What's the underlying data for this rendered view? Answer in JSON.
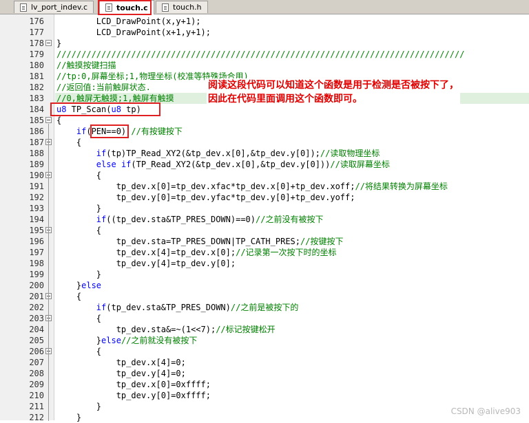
{
  "tabs": [
    {
      "label": "lv_port_indev.c"
    },
    {
      "label": "touch.c"
    },
    {
      "label": "touch.h"
    }
  ],
  "annotation": {
    "line1": "阅读这段代码可以知道这个函数是用于检测是否被按下了，",
    "line2": "因此在代码里面调用这个函数即可。"
  },
  "watermark": "CSDN @alive903",
  "lines": [
    {
      "n": "176",
      "t": "        LCD_DrawPoint(x,y+1);"
    },
    {
      "n": "177",
      "t": "        LCD_DrawPoint(x+1,y+1);"
    },
    {
      "n": "178",
      "t": "}"
    },
    {
      "n": "179",
      "t": "//////////////////////////////////////////////////////////////////////////////////"
    },
    {
      "n": "180",
      "t": "//触摸按键扫描"
    },
    {
      "n": "181",
      "t": "//tp:0,屏幕坐标;1,物理坐标(校准等特殊场合用)"
    },
    {
      "n": "182",
      "t": "//返回值:当前触屏状态."
    },
    {
      "n": "183",
      "t": "//0,触屏无触摸;1,触屏有触摸"
    },
    {
      "n": "184",
      "t": "u8 TP_Scan(u8 tp)"
    },
    {
      "n": "185",
      "t": "{"
    },
    {
      "n": "186",
      "t": "    if(PEN==0) //有按键按下"
    },
    {
      "n": "187",
      "t": "    {"
    },
    {
      "n": "188",
      "t": "        if(tp)TP_Read_XY2(&tp_dev.x[0],&tp_dev.y[0]);//读取物理坐标"
    },
    {
      "n": "189",
      "t": "        else if(TP_Read_XY2(&tp_dev.x[0],&tp_dev.y[0]))//读取屏幕坐标"
    },
    {
      "n": "190",
      "t": "        {"
    },
    {
      "n": "191",
      "t": "            tp_dev.x[0]=tp_dev.xfac*tp_dev.x[0]+tp_dev.xoff;//将结果转换为屏幕坐标"
    },
    {
      "n": "192",
      "t": "            tp_dev.y[0]=tp_dev.yfac*tp_dev.y[0]+tp_dev.yoff;"
    },
    {
      "n": "193",
      "t": "        }"
    },
    {
      "n": "194",
      "t": "        if((tp_dev.sta&TP_PRES_DOWN)==0)//之前没有被按下"
    },
    {
      "n": "195",
      "t": "        {"
    },
    {
      "n": "196",
      "t": "            tp_dev.sta=TP_PRES_DOWN|TP_CATH_PRES;//按键按下"
    },
    {
      "n": "197",
      "t": "            tp_dev.x[4]=tp_dev.x[0];//记录第一次按下时的坐标"
    },
    {
      "n": "198",
      "t": "            tp_dev.y[4]=tp_dev.y[0];"
    },
    {
      "n": "199",
      "t": "        }"
    },
    {
      "n": "200",
      "t": "    }else"
    },
    {
      "n": "201",
      "t": "    {"
    },
    {
      "n": "202",
      "t": "        if(tp_dev.sta&TP_PRES_DOWN)//之前是被按下的"
    },
    {
      "n": "203",
      "t": "        {"
    },
    {
      "n": "204",
      "t": "            tp_dev.sta&=~(1<<7);//标记按键松开"
    },
    {
      "n": "205",
      "t": "        }else//之前就没有被按下"
    },
    {
      "n": "206",
      "t": "        {"
    },
    {
      "n": "207",
      "t": "            tp_dev.x[4]=0;"
    },
    {
      "n": "208",
      "t": "            tp_dev.y[4]=0;"
    },
    {
      "n": "209",
      "t": "            tp_dev.x[0]=0xffff;"
    },
    {
      "n": "210",
      "t": "            tp_dev.y[0]=0xffff;"
    },
    {
      "n": "211",
      "t": "        }"
    },
    {
      "n": "212",
      "t": "    }"
    }
  ],
  "colors": {
    "comment": "#008000",
    "keyword": "#0000ff",
    "highlight_box": "#e02020",
    "annotation": "#e00000",
    "current_line": "#dff0df"
  }
}
